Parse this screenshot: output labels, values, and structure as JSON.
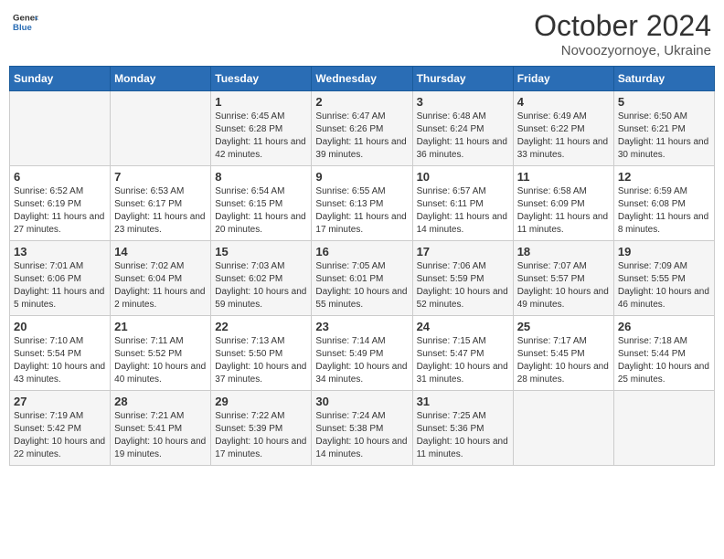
{
  "header": {
    "logo_line1": "General",
    "logo_line2": "Blue",
    "month": "October 2024",
    "location": "Novoozyornoye, Ukraine"
  },
  "weekdays": [
    "Sunday",
    "Monday",
    "Tuesday",
    "Wednesday",
    "Thursday",
    "Friday",
    "Saturday"
  ],
  "weeks": [
    [
      {
        "day": "",
        "info": ""
      },
      {
        "day": "",
        "info": ""
      },
      {
        "day": "1",
        "info": "Sunrise: 6:45 AM\nSunset: 6:28 PM\nDaylight: 11 hours and 42 minutes."
      },
      {
        "day": "2",
        "info": "Sunrise: 6:47 AM\nSunset: 6:26 PM\nDaylight: 11 hours and 39 minutes."
      },
      {
        "day": "3",
        "info": "Sunrise: 6:48 AM\nSunset: 6:24 PM\nDaylight: 11 hours and 36 minutes."
      },
      {
        "day": "4",
        "info": "Sunrise: 6:49 AM\nSunset: 6:22 PM\nDaylight: 11 hours and 33 minutes."
      },
      {
        "day": "5",
        "info": "Sunrise: 6:50 AM\nSunset: 6:21 PM\nDaylight: 11 hours and 30 minutes."
      }
    ],
    [
      {
        "day": "6",
        "info": "Sunrise: 6:52 AM\nSunset: 6:19 PM\nDaylight: 11 hours and 27 minutes."
      },
      {
        "day": "7",
        "info": "Sunrise: 6:53 AM\nSunset: 6:17 PM\nDaylight: 11 hours and 23 minutes."
      },
      {
        "day": "8",
        "info": "Sunrise: 6:54 AM\nSunset: 6:15 PM\nDaylight: 11 hours and 20 minutes."
      },
      {
        "day": "9",
        "info": "Sunrise: 6:55 AM\nSunset: 6:13 PM\nDaylight: 11 hours and 17 minutes."
      },
      {
        "day": "10",
        "info": "Sunrise: 6:57 AM\nSunset: 6:11 PM\nDaylight: 11 hours and 14 minutes."
      },
      {
        "day": "11",
        "info": "Sunrise: 6:58 AM\nSunset: 6:09 PM\nDaylight: 11 hours and 11 minutes."
      },
      {
        "day": "12",
        "info": "Sunrise: 6:59 AM\nSunset: 6:08 PM\nDaylight: 11 hours and 8 minutes."
      }
    ],
    [
      {
        "day": "13",
        "info": "Sunrise: 7:01 AM\nSunset: 6:06 PM\nDaylight: 11 hours and 5 minutes."
      },
      {
        "day": "14",
        "info": "Sunrise: 7:02 AM\nSunset: 6:04 PM\nDaylight: 11 hours and 2 minutes."
      },
      {
        "day": "15",
        "info": "Sunrise: 7:03 AM\nSunset: 6:02 PM\nDaylight: 10 hours and 59 minutes."
      },
      {
        "day": "16",
        "info": "Sunrise: 7:05 AM\nSunset: 6:01 PM\nDaylight: 10 hours and 55 minutes."
      },
      {
        "day": "17",
        "info": "Sunrise: 7:06 AM\nSunset: 5:59 PM\nDaylight: 10 hours and 52 minutes."
      },
      {
        "day": "18",
        "info": "Sunrise: 7:07 AM\nSunset: 5:57 PM\nDaylight: 10 hours and 49 minutes."
      },
      {
        "day": "19",
        "info": "Sunrise: 7:09 AM\nSunset: 5:55 PM\nDaylight: 10 hours and 46 minutes."
      }
    ],
    [
      {
        "day": "20",
        "info": "Sunrise: 7:10 AM\nSunset: 5:54 PM\nDaylight: 10 hours and 43 minutes."
      },
      {
        "day": "21",
        "info": "Sunrise: 7:11 AM\nSunset: 5:52 PM\nDaylight: 10 hours and 40 minutes."
      },
      {
        "day": "22",
        "info": "Sunrise: 7:13 AM\nSunset: 5:50 PM\nDaylight: 10 hours and 37 minutes."
      },
      {
        "day": "23",
        "info": "Sunrise: 7:14 AM\nSunset: 5:49 PM\nDaylight: 10 hours and 34 minutes."
      },
      {
        "day": "24",
        "info": "Sunrise: 7:15 AM\nSunset: 5:47 PM\nDaylight: 10 hours and 31 minutes."
      },
      {
        "day": "25",
        "info": "Sunrise: 7:17 AM\nSunset: 5:45 PM\nDaylight: 10 hours and 28 minutes."
      },
      {
        "day": "26",
        "info": "Sunrise: 7:18 AM\nSunset: 5:44 PM\nDaylight: 10 hours and 25 minutes."
      }
    ],
    [
      {
        "day": "27",
        "info": "Sunrise: 7:19 AM\nSunset: 5:42 PM\nDaylight: 10 hours and 22 minutes."
      },
      {
        "day": "28",
        "info": "Sunrise: 7:21 AM\nSunset: 5:41 PM\nDaylight: 10 hours and 19 minutes."
      },
      {
        "day": "29",
        "info": "Sunrise: 7:22 AM\nSunset: 5:39 PM\nDaylight: 10 hours and 17 minutes."
      },
      {
        "day": "30",
        "info": "Sunrise: 7:24 AM\nSunset: 5:38 PM\nDaylight: 10 hours and 14 minutes."
      },
      {
        "day": "31",
        "info": "Sunrise: 7:25 AM\nSunset: 5:36 PM\nDaylight: 10 hours and 11 minutes."
      },
      {
        "day": "",
        "info": ""
      },
      {
        "day": "",
        "info": ""
      }
    ]
  ]
}
